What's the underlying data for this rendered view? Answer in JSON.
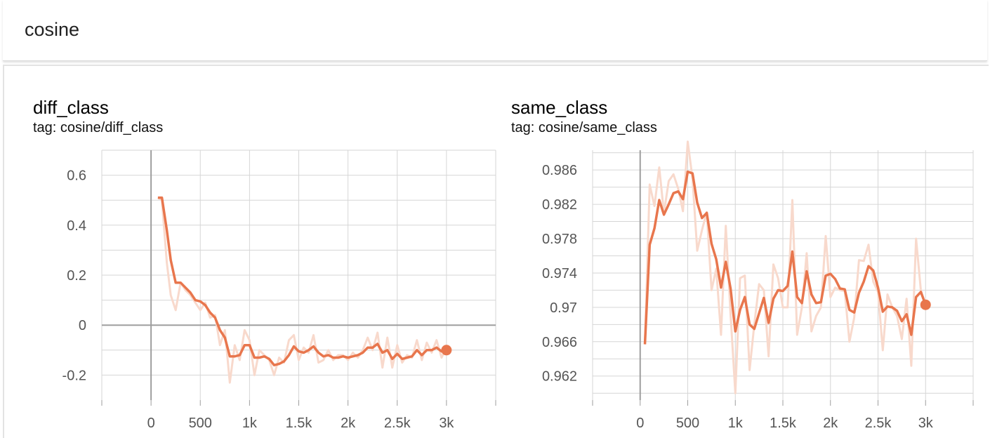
{
  "header": {
    "title": "cosine"
  },
  "colors": {
    "accent": "#e8764d",
    "accent_light": "#f8d9cc",
    "grid": "#d6d6d6",
    "axis": "#9e9e9e"
  },
  "chart_data": [
    {
      "type": "line",
      "title": "diff_class",
      "subtitle": "tag: cosine/diff_class",
      "xlabel": "",
      "ylabel": "",
      "xlim": [
        -500,
        3500
      ],
      "ylim": [
        -0.3,
        0.7
      ],
      "grid": true,
      "xticks": [
        0,
        500,
        1000,
        1500,
        2000,
        2500,
        3000
      ],
      "xtick_labels": [
        "0",
        "500",
        "1k",
        "1.5k",
        "2k",
        "2.5k",
        "3k"
      ],
      "yticks": [
        -0.2,
        0,
        0.2,
        0.4,
        0.6
      ],
      "ytick_labels": [
        "-0.2",
        "0",
        "0.2",
        "0.4",
        "0.6"
      ],
      "series": [
        {
          "x": [
            70,
            110,
            160,
            200,
            250,
            300,
            350,
            400,
            450,
            500,
            550,
            600,
            650,
            700,
            750,
            800,
            850,
            900,
            950,
            1000,
            1050,
            1100,
            1150,
            1200,
            1250,
            1300,
            1350,
            1400,
            1450,
            1500,
            1550,
            1600,
            1650,
            1700,
            1750,
            1800,
            1850,
            1900,
            1950,
            2000,
            2050,
            2100,
            2150,
            2200,
            2250,
            2300,
            2350,
            2400,
            2450,
            2500,
            2550,
            2600,
            2650,
            2700,
            2750,
            2800,
            2850,
            2900,
            2950,
            3000
          ],
          "y": [
            0.51,
            0.51,
            0.38,
            0.26,
            0.17,
            0.17,
            0.15,
            0.13,
            0.1,
            0.095,
            0.08,
            0.05,
            0.03,
            -0.02,
            -0.05,
            -0.125,
            -0.125,
            -0.12,
            -0.08,
            -0.08,
            -0.13,
            -0.13,
            -0.125,
            -0.135,
            -0.16,
            -0.155,
            -0.145,
            -0.12,
            -0.085,
            -0.105,
            -0.11,
            -0.1,
            -0.085,
            -0.11,
            -0.125,
            -0.12,
            -0.13,
            -0.13,
            -0.125,
            -0.13,
            -0.125,
            -0.12,
            -0.11,
            -0.09,
            -0.09,
            -0.075,
            -0.11,
            -0.1,
            -0.135,
            -0.115,
            -0.135,
            -0.13,
            -0.125,
            -0.1,
            -0.12,
            -0.1,
            -0.1,
            -0.09,
            -0.105,
            -0.1
          ]
        },
        {
          "x": [
            70,
            110,
            160,
            200,
            250,
            300,
            350,
            400,
            450,
            500,
            550,
            600,
            650,
            700,
            750,
            800,
            850,
            900,
            950,
            1000,
            1050,
            1100,
            1150,
            1200,
            1250,
            1300,
            1350,
            1400,
            1450,
            1500,
            1550,
            1600,
            1650,
            1700,
            1750,
            1800,
            1850,
            1900,
            1950,
            2000,
            2050,
            2100,
            2150,
            2200,
            2250,
            2300,
            2350,
            2400,
            2450,
            2500,
            2550,
            2600,
            2650,
            2700,
            2750,
            2800,
            2850,
            2900,
            2950,
            3000
          ],
          "y": [
            0.51,
            0.5,
            0.25,
            0.12,
            0.06,
            0.17,
            0.14,
            0.12,
            0.09,
            0.06,
            0.09,
            0.03,
            0.04,
            -0.08,
            -0.02,
            -0.23,
            -0.08,
            -0.14,
            -0.02,
            -0.06,
            -0.2,
            -0.1,
            -0.12,
            -0.14,
            -0.2,
            -0.13,
            -0.15,
            -0.06,
            -0.04,
            -0.14,
            -0.09,
            -0.11,
            -0.04,
            -0.15,
            -0.14,
            -0.1,
            -0.14,
            -0.12,
            -0.12,
            -0.14,
            -0.11,
            -0.13,
            -0.1,
            -0.05,
            -0.1,
            -0.03,
            -0.17,
            -0.05,
            -0.17,
            -0.08,
            -0.15,
            -0.12,
            -0.13,
            -0.06,
            -0.14,
            -0.07,
            -0.11,
            -0.06,
            -0.13,
            -0.09
          ]
        }
      ]
    },
    {
      "type": "line",
      "title": "same_class",
      "subtitle": "tag: cosine/same_class",
      "xlabel": "",
      "ylabel": "",
      "xlim": [
        -500,
        3500
      ],
      "ylim": [
        0.9592,
        0.9883
      ],
      "grid": true,
      "xticks": [
        0,
        500,
        1000,
        1500,
        2000,
        2500,
        3000
      ],
      "xtick_labels": [
        "0",
        "500",
        "1k",
        "1.5k",
        "2k",
        "2.5k",
        "3k"
      ],
      "yticks": [
        0.962,
        0.966,
        0.97,
        0.974,
        0.978,
        0.982,
        0.986
      ],
      "ytick_labels": [
        "0.962",
        "0.966",
        "0.97",
        "0.974",
        "0.978",
        "0.982",
        "0.986"
      ],
      "series": [
        {
          "x": [
            50,
            100,
            150,
            200,
            250,
            300,
            350,
            400,
            450,
            500,
            550,
            600,
            650,
            700,
            750,
            800,
            850,
            900,
            950,
            1000,
            1050,
            1100,
            1150,
            1200,
            1250,
            1300,
            1350,
            1400,
            1450,
            1500,
            1550,
            1600,
            1650,
            1700,
            1750,
            1800,
            1850,
            1900,
            1950,
            2000,
            2050,
            2100,
            2150,
            2200,
            2250,
            2300,
            2350,
            2400,
            2450,
            2500,
            2550,
            2600,
            2650,
            2700,
            2750,
            2800,
            2850,
            2900,
            2950,
            3000
          ],
          "y": [
            0.9657,
            0.9773,
            0.9792,
            0.9825,
            0.9808,
            0.982,
            0.9833,
            0.9835,
            0.9826,
            0.9858,
            0.9856,
            0.9822,
            0.9804,
            0.981,
            0.9774,
            0.9756,
            0.9723,
            0.9753,
            0.9722,
            0.9672,
            0.9697,
            0.9712,
            0.968,
            0.9675,
            0.9693,
            0.9711,
            0.9682,
            0.971,
            0.972,
            0.9719,
            0.9725,
            0.9765,
            0.9712,
            0.9705,
            0.9742,
            0.9715,
            0.9705,
            0.9706,
            0.9737,
            0.9739,
            0.9733,
            0.9722,
            0.9721,
            0.9697,
            0.9694,
            0.9717,
            0.973,
            0.9748,
            0.9743,
            0.9723,
            0.9695,
            0.9701,
            0.97,
            0.9696,
            0.9684,
            0.9692,
            0.9668,
            0.9712,
            0.9718,
            0.9703
          ]
        },
        {
          "x": [
            50,
            100,
            150,
            200,
            250,
            300,
            350,
            400,
            450,
            500,
            550,
            600,
            650,
            700,
            750,
            800,
            850,
            900,
            950,
            1000,
            1050,
            1100,
            1150,
            1200,
            1250,
            1300,
            1350,
            1400,
            1450,
            1500,
            1550,
            1600,
            1650,
            1700,
            1750,
            1800,
            1850,
            1900,
            1950,
            2000,
            2050,
            2100,
            2150,
            2200,
            2250,
            2300,
            2350,
            2400,
            2450,
            2500,
            2550,
            2600,
            2650,
            2700,
            2750,
            2800,
            2850,
            2900,
            2950,
            3000
          ],
          "y": [
            0.9657,
            0.9843,
            0.9818,
            0.9863,
            0.981,
            0.9847,
            0.9855,
            0.9838,
            0.9812,
            0.9893,
            0.985,
            0.9766,
            0.979,
            0.9811,
            0.972,
            0.9745,
            0.9668,
            0.9795,
            0.9692,
            0.96,
            0.9734,
            0.9737,
            0.9627,
            0.968,
            0.9727,
            0.972,
            0.9643,
            0.975,
            0.9734,
            0.97,
            0.97,
            0.9825,
            0.9668,
            0.97,
            0.9763,
            0.9672,
            0.969,
            0.97,
            0.9783,
            0.9712,
            0.9723,
            0.972,
            0.9719,
            0.966,
            0.9688,
            0.9755,
            0.9754,
            0.9773,
            0.973,
            0.9718,
            0.965,
            0.9715,
            0.97,
            0.969,
            0.9663,
            0.971,
            0.9632,
            0.978,
            0.972,
            0.97
          ]
        }
      ]
    }
  ]
}
